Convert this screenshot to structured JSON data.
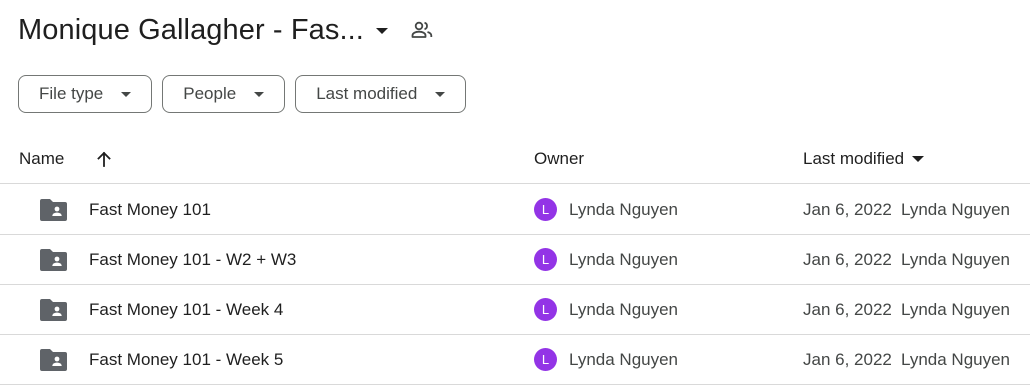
{
  "header": {
    "title": "Monique Gallagher - Fas...",
    "shared_icon": "people-icon"
  },
  "filters": [
    {
      "label": "File type"
    },
    {
      "label": "People"
    },
    {
      "label": "Last modified"
    }
  ],
  "table": {
    "columns": {
      "name": "Name",
      "owner": "Owner",
      "last_modified": "Last modified"
    },
    "sort_icon": "arrow-up-icon",
    "rows": [
      {
        "name": "Fast Money 101",
        "owner_initial": "L",
        "owner": "Lynda Nguyen",
        "date": "Jan 6, 2022",
        "modified_by": "Lynda Nguyen",
        "icon": "shared-folder-icon"
      },
      {
        "name": "Fast Money 101 - W2 + W3",
        "owner_initial": "L",
        "owner": "Lynda Nguyen",
        "date": "Jan 6, 2022",
        "modified_by": "Lynda Nguyen",
        "icon": "shared-folder-icon"
      },
      {
        "name": "Fast Money 101 - Week 4",
        "owner_initial": "L",
        "owner": "Lynda Nguyen",
        "date": "Jan 6, 2022",
        "modified_by": "Lynda Nguyen",
        "icon": "shared-folder-icon"
      },
      {
        "name": "Fast Money 101 - Week 5",
        "owner_initial": "L",
        "owner": "Lynda Nguyen",
        "date": "Jan 6, 2022",
        "modified_by": "Lynda Nguyen",
        "icon": "shared-folder-icon"
      }
    ]
  },
  "colors": {
    "avatar": "#9334e6",
    "folder": "#5f6368",
    "border": "#747775",
    "divider": "#d9d9d9"
  }
}
